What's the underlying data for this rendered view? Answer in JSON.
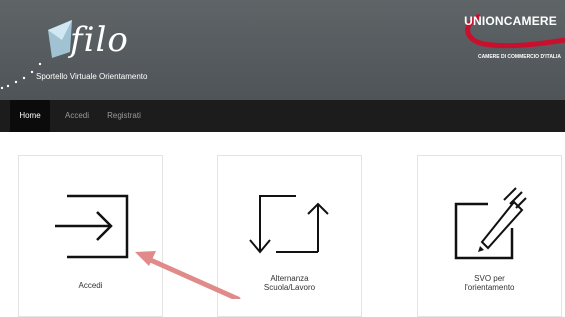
{
  "header": {
    "logo_text": "filo",
    "logo_subtitle": "Sportello Virtuale Orientamento",
    "partner_title": "UNIONCAMERE",
    "partner_subtitle": "CAMERE DI COMMERCIO D'ITALIA"
  },
  "nav": {
    "items": [
      {
        "label": "Home"
      },
      {
        "label": "Accedi"
      },
      {
        "label": "Registrati"
      }
    ]
  },
  "cards": [
    {
      "label_line1": "Accedi",
      "label_line2": "",
      "icon": "login-icon"
    },
    {
      "label_line1": "Alternanza",
      "label_line2": "Scuola/Lavoro",
      "icon": "up-down-arrows-icon"
    },
    {
      "label_line1": "SVO per",
      "label_line2": "l'orientamento",
      "icon": "edit-pen-icon"
    }
  ],
  "colors": {
    "header_bg": "#575d60",
    "navbar_bg": "#1c1c1c",
    "accent_red": "#c8102e",
    "annotation_arrow": "#e08a8a"
  }
}
